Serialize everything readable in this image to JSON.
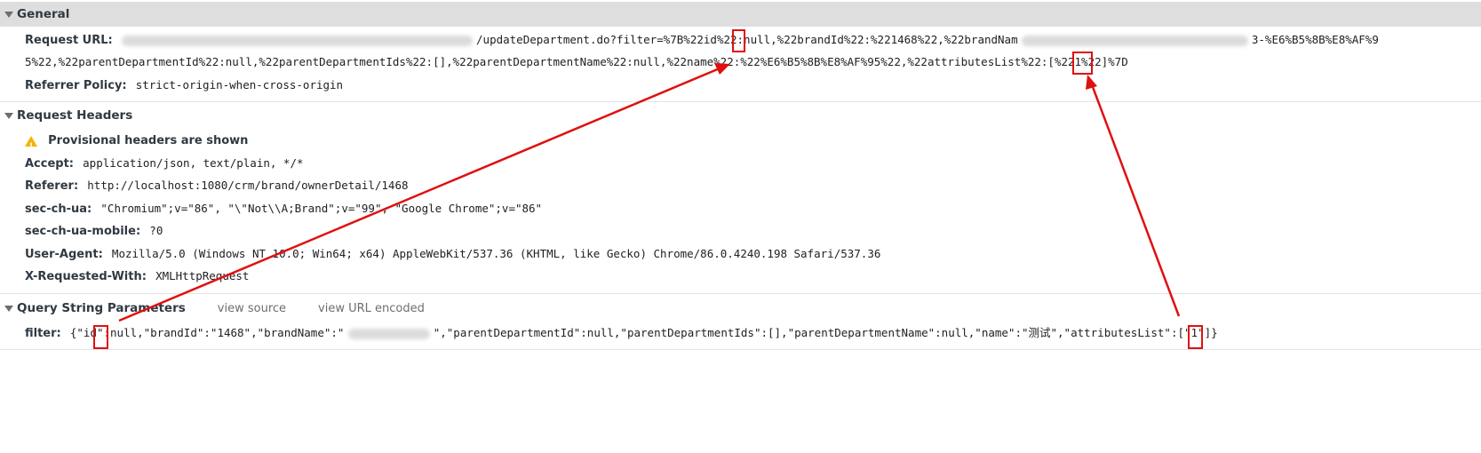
{
  "general": {
    "title": "General",
    "request_url_label": "Request URL:",
    "request_url_line1": "/updateDepartment.do?filter=%7B%22id%22:null,%22brandId%22:%221468%22,%22brandNam",
    "request_url_line1_tail": "3-%E6%B5%8B%E8%AF%9",
    "request_url_line2": "5%22,%22parentDepartmentId%22:null,%22parentDepartmentIds%22:[],%22parentDepartmentName%22:null,%22name%22:%22%E6%B5%8B%E8%AF%95%22,%22attributesList%22:[%221%22]%7D",
    "referrer_policy_label": "Referrer Policy:",
    "referrer_policy_value": "strict-origin-when-cross-origin"
  },
  "request_headers": {
    "title": "Request Headers",
    "provisional": "Provisional headers are shown",
    "rows": [
      {
        "key": "Accept:",
        "value": "application/json, text/plain, */*"
      },
      {
        "key": "Referer:",
        "value": "http://localhost:1080/crm/brand/ownerDetail/1468"
      },
      {
        "key": "sec-ch-ua:",
        "value": "\"Chromium\";v=\"86\", \"\\\"Not\\\\A;Brand\";v=\"99\", \"Google Chrome\";v=\"86\""
      },
      {
        "key": "sec-ch-ua-mobile:",
        "value": "?0"
      },
      {
        "key": "User-Agent:",
        "value": "Mozilla/5.0 (Windows NT 10.0; Win64; x64) AppleWebKit/537.36 (KHTML, like Gecko) Chrome/86.0.4240.198 Safari/537.36"
      },
      {
        "key": "X-Requested-With:",
        "value": "XMLHttpRequest"
      }
    ]
  },
  "query_string": {
    "title": "Query String Parameters",
    "view_source": "view source",
    "view_url_encoded": "view URL encoded",
    "filter_label": "filter:",
    "filter_part1": "{\"id\":null,\"brandId\":\"1468\",\"brandName\":\"",
    "filter_part2": "\",\"parentDepartmentId\":null,\"parentDepartmentIds\":[],\"parentDepartmentName\":null,\"name\":\"测试\",\"attributesList\":[\"1\"]}"
  },
  "colors": {
    "annotation": "#e01010",
    "header_bg": "#dedede"
  },
  "icons": {
    "expand": "triangle-down-icon",
    "warning": "warning-icon"
  }
}
